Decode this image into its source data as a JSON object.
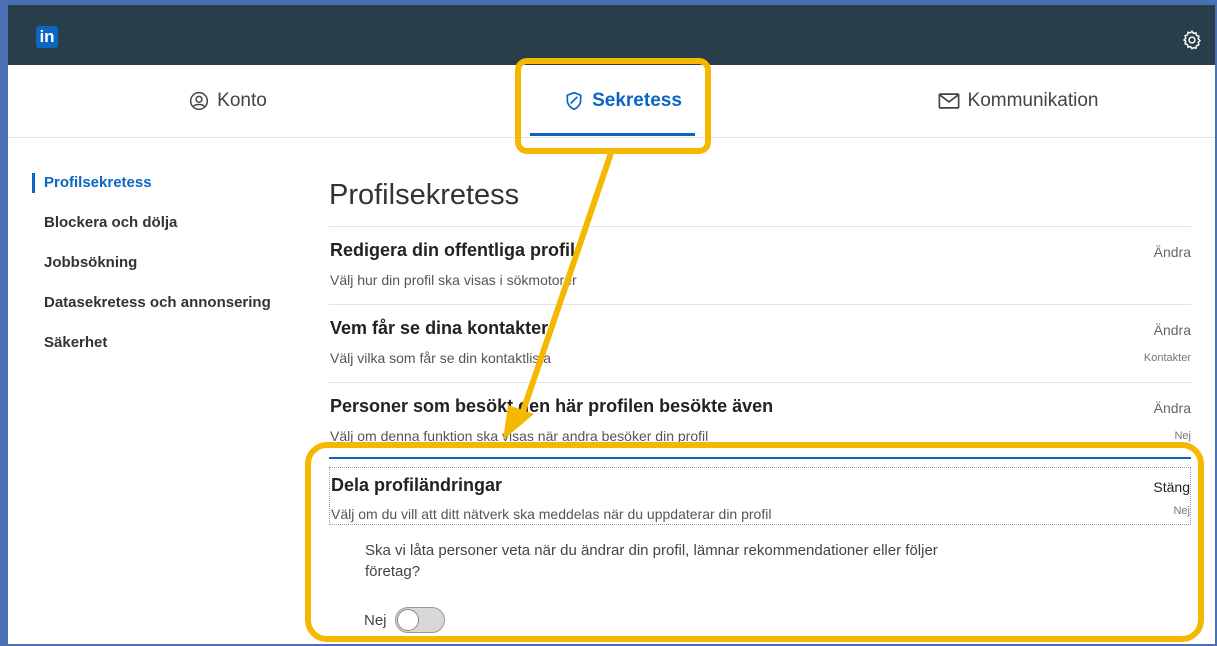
{
  "topbar": {
    "logo_text": "in",
    "settings_icon": "gear-icon"
  },
  "tabs": [
    {
      "label": "Konto",
      "icon": "user-circle-icon"
    },
    {
      "label": "Sekretess",
      "icon": "shield-icon",
      "active": true
    },
    {
      "label": "Kommunikation",
      "icon": "envelope-icon"
    }
  ],
  "sidebar": {
    "items": [
      {
        "label": "Profilsekretess",
        "active": true
      },
      {
        "label": "Blockera och dölja"
      },
      {
        "label": "Jobbsökning"
      },
      {
        "label": "Datasekretess och annonsering"
      },
      {
        "label": "Säkerhet"
      }
    ]
  },
  "main": {
    "title": "Profilsekretess",
    "rows": [
      {
        "title": "Redigera din offentliga profil",
        "desc": "Välj hur din profil ska visas i sökmotorer",
        "action": "Ändra",
        "value": ""
      },
      {
        "title": "Vem får se dina kontakter",
        "desc": "Välj vilka som får se din kontaktlista",
        "action": "Ändra",
        "value": "Kontakter"
      },
      {
        "title": "Personer som besökt den här profilen besökte även",
        "desc": "Välj om denna funktion ska visas när andra besöker din profil",
        "action": "Ändra",
        "value": "Nej"
      }
    ],
    "expanded": {
      "title": "Dela profiländringar",
      "desc": "Välj om du vill att ditt nätverk ska meddelas när du uppdaterar din profil",
      "action": "Stäng",
      "value": "Nej",
      "question": "Ska vi låta personer veta när du ändrar din profil, lämnar rekommendationer eller följer företag?",
      "toggle_label": "Nej",
      "toggle_on": false
    }
  },
  "colors": {
    "accent": "#0a66c2",
    "highlight": "#f5b800",
    "topbar": "#283e4a"
  }
}
